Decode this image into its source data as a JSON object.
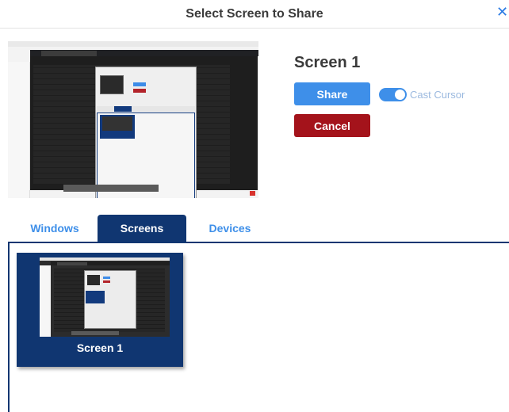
{
  "dialog": {
    "title": "Select Screen to Share",
    "close_icon": "close-icon"
  },
  "selected": {
    "name": "Screen 1",
    "share_label": "Share",
    "cancel_label": "Cancel",
    "cast_cursor_label": "Cast Cursor",
    "cast_cursor_on": true
  },
  "tabs": [
    {
      "label": "Windows",
      "active": false
    },
    {
      "label": "Screens",
      "active": true
    },
    {
      "label": "Devices",
      "active": false
    }
  ],
  "screens": [
    {
      "label": "Screen 1",
      "selected": true
    }
  ],
  "colors": {
    "accent": "#3e8fe9",
    "navy": "#103671",
    "cancel": "#a4131b"
  }
}
